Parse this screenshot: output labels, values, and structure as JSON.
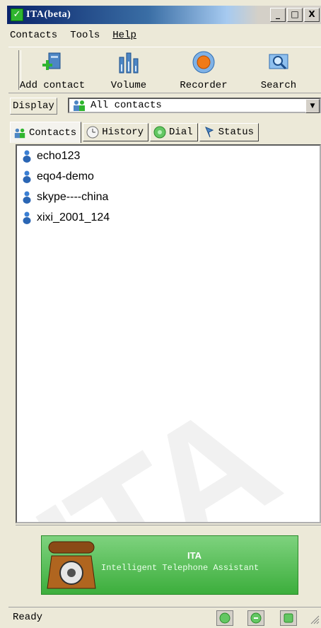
{
  "window": {
    "title": "ITA(beta)",
    "min_label": "_",
    "max_label": "□",
    "close_label": "X"
  },
  "menu": {
    "items": [
      "Contacts",
      "Tools",
      "Help"
    ]
  },
  "toolbar": {
    "buttons": [
      "Add contact",
      "Volume",
      "Recorder",
      "Search"
    ]
  },
  "display": {
    "label": "Display",
    "selected": "All contacts"
  },
  "tabs": [
    "Contacts",
    "History",
    "Dial",
    "Status"
  ],
  "contacts": [
    "echo123",
    "eqo4-demo",
    "skype----china",
    "xixi_2001_124"
  ],
  "banner": {
    "title": "ITA",
    "subtitle": "Intelligent Telephone Assistant"
  },
  "watermark": "ITA",
  "status": {
    "text": "Ready"
  },
  "icons": {
    "app": "app-check-icon",
    "add_contact": "add-contact-icon",
    "volume": "volume-bars-icon",
    "recorder": "record-icon",
    "search": "search-icon",
    "contact": "user-icon"
  },
  "colors": {
    "accent_green": "#3cae3c",
    "title_blue": "#0a246a"
  }
}
